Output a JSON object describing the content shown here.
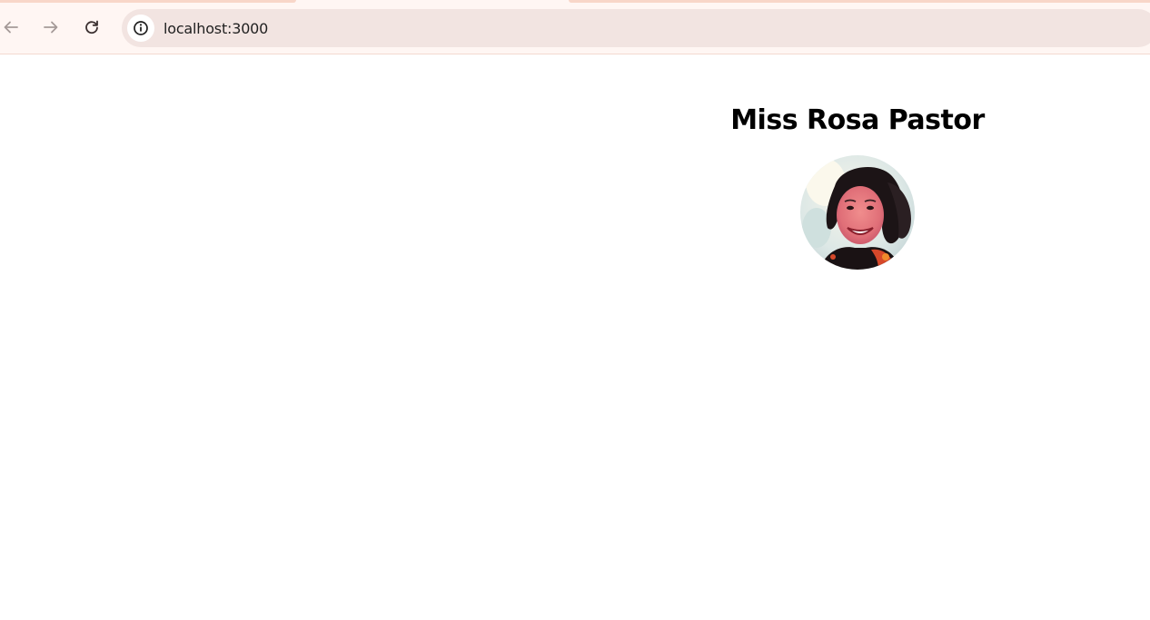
{
  "browser": {
    "url": "localhost:3000"
  },
  "profile": {
    "name": "Miss Rosa Pastor"
  },
  "icons": {
    "back": "arrow-left-icon",
    "forward": "arrow-right-icon",
    "reload": "reload-icon",
    "site_info": "info-icon"
  },
  "colors": {
    "toolbar_bg": "#fff6f3",
    "address_bar_bg": "#f2e4e1",
    "tab_accent": "#f8d6c8"
  }
}
